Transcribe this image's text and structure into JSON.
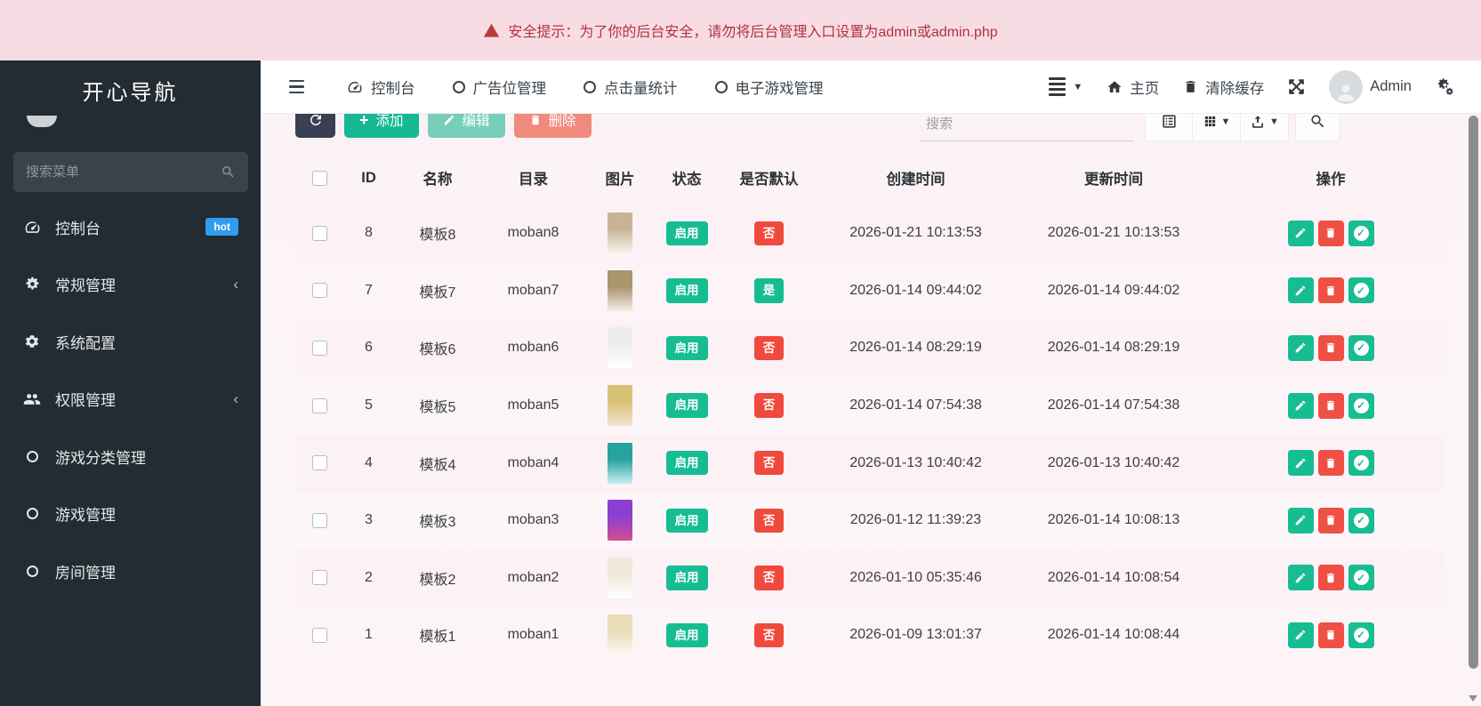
{
  "banner": {
    "text": "安全提示：为了你的后台安全，请勿将后台管理入口设置为admin或admin.php"
  },
  "sidebar": {
    "title": "开心导航",
    "search_placeholder": "搜索菜单",
    "items": [
      {
        "label": "控制台",
        "icon": "dashboard-icon",
        "badge": "hot"
      },
      {
        "label": "常规管理",
        "icon": "cogs-icon",
        "arrow": "‹"
      },
      {
        "label": "系统配置",
        "icon": "gear-icon"
      },
      {
        "label": "权限管理",
        "icon": "users-icon",
        "arrow": "‹"
      },
      {
        "label": "游戏分类管理",
        "icon": "circle-icon"
      },
      {
        "label": "游戏管理",
        "icon": "circle-icon"
      },
      {
        "label": "房间管理",
        "icon": "circle-icon"
      }
    ]
  },
  "navbar": {
    "tabs": [
      {
        "label": "控制台",
        "icon": "dashboard-icon"
      },
      {
        "label": "广告位管理",
        "icon": "circle-icon"
      },
      {
        "label": "点击量统计",
        "icon": "circle-icon"
      },
      {
        "label": "电子游戏管理",
        "icon": "circle-icon"
      }
    ],
    "home_label": "主页",
    "clear_cache_label": "清除缓存",
    "username": "Admin"
  },
  "toolbar": {
    "add_label": "添加",
    "edit_label": "编辑",
    "delete_label": "删除",
    "search_placeholder": "搜索"
  },
  "table": {
    "columns": [
      "ID",
      "名称",
      "目录",
      "图片",
      "状态",
      "是否默认",
      "创建时间",
      "更新时间",
      "操作"
    ],
    "rows": [
      {
        "id": "8",
        "name": "模板8",
        "dir": "moban8",
        "status": "启用",
        "default": "否",
        "created": "2026-01-21 10:13:53",
        "updated": "2026-01-21 10:13:53",
        "thumb": [
          "#c8b394",
          "#f7f4ee"
        ]
      },
      {
        "id": "7",
        "name": "模板7",
        "dir": "moban7",
        "status": "启用",
        "default": "是",
        "created": "2026-01-14 09:44:02",
        "updated": "2026-01-14 09:44:02",
        "thumb": [
          "#a9946e",
          "#f3efe7"
        ]
      },
      {
        "id": "6",
        "name": "模板6",
        "dir": "moban6",
        "status": "启用",
        "default": "否",
        "created": "2026-01-14 08:29:19",
        "updated": "2026-01-14 08:29:19",
        "thumb": [
          "#ececec",
          "#ffffff"
        ]
      },
      {
        "id": "5",
        "name": "模板5",
        "dir": "moban5",
        "status": "启用",
        "default": "否",
        "created": "2026-01-14 07:54:38",
        "updated": "2026-01-14 07:54:38",
        "thumb": [
          "#d7c273",
          "#f1e3d5"
        ]
      },
      {
        "id": "4",
        "name": "模板4",
        "dir": "moban4",
        "status": "启用",
        "default": "否",
        "created": "2026-01-13 10:40:42",
        "updated": "2026-01-13 10:40:42",
        "thumb": [
          "#27a39f",
          "#c8ecf4"
        ]
      },
      {
        "id": "3",
        "name": "模板3",
        "dir": "moban3",
        "status": "启用",
        "default": "否",
        "created": "2026-01-12 11:39:23",
        "updated": "2026-01-14 10:08:13",
        "thumb": [
          "#8a3fd1",
          "#d44f92"
        ]
      },
      {
        "id": "2",
        "name": "模板2",
        "dir": "moban2",
        "status": "启用",
        "default": "否",
        "created": "2026-01-10 05:35:46",
        "updated": "2026-01-14 10:08:54",
        "thumb": [
          "#efe9dc",
          "#ffffff"
        ]
      },
      {
        "id": "1",
        "name": "模板1",
        "dir": "moban1",
        "status": "启用",
        "default": "否",
        "created": "2026-01-09 13:01:37",
        "updated": "2026-01-14 10:08:44",
        "thumb": [
          "#e9dcb8",
          "#fbf8f2"
        ]
      }
    ]
  },
  "colors": {
    "accent_green": "#16bd93",
    "accent_red": "#f0493e",
    "hot_blue": "#2e9df0",
    "sidebar_bg": "#232c32",
    "banner_bg": "#f8dce3",
    "banner_text": "#b03245",
    "refresh_dark": "#3a4053",
    "stripe_pink": "#fcf1f5"
  }
}
